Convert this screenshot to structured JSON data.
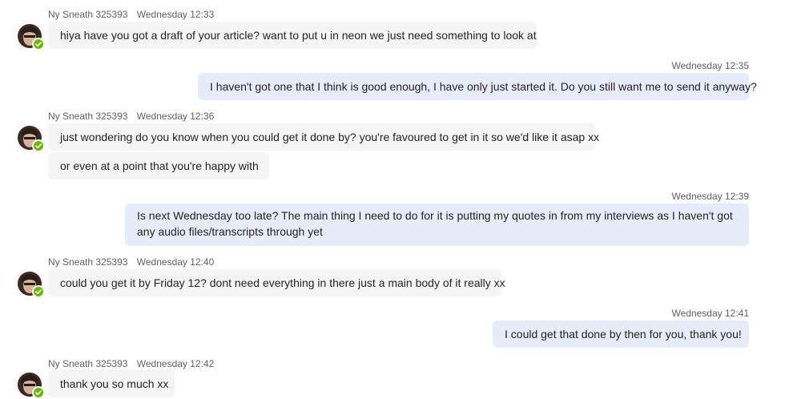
{
  "messages": [
    {
      "kind": "in",
      "sender": "Ny Sneath 325393",
      "time": "Wednesday 12:33",
      "lines": [
        "hiya have you got a draft of your article? want to put u in neon we just need something to look at"
      ]
    },
    {
      "kind": "out",
      "time": "Wednesday 12:35",
      "lines": [
        "I haven't got one that I think is good enough, I have only just started it. Do you still want me to send it anyway?"
      ]
    },
    {
      "kind": "in",
      "sender": "Ny Sneath 325393",
      "time": "Wednesday 12:36",
      "lines": [
        "just wondering do you know when you could get it done by? you're favoured to get in it so we'd like it asap xx",
        "or even at a point that you're happy with"
      ]
    },
    {
      "kind": "out",
      "time": "Wednesday 12:39",
      "lines": [
        "Is next Wednesday too late? The main thing I need to do for it is putting my quotes in from my interviews as I haven't got any audio files/transcripts through yet"
      ]
    },
    {
      "kind": "in",
      "sender": "Ny Sneath 325393",
      "time": "Wednesday 12:40",
      "lines": [
        "could you get it by Friday 12? dont need everything in there just a main body of it really xx"
      ]
    },
    {
      "kind": "out",
      "time": "Wednesday 12:41",
      "lines": [
        "I could get that done by then for you, thank you!"
      ]
    },
    {
      "kind": "in",
      "sender": "Ny Sneath 325393",
      "time": "Wednesday 12:42",
      "lines": [
        "thank you so much xx"
      ]
    }
  ],
  "colors": {
    "incoming_bubble": "#f5f5f5",
    "outgoing_bubble": "#e8ebfa",
    "meta_text": "#616161",
    "presence_available": "#6bb700"
  },
  "icons": {
    "avatar": "contact-photo",
    "presence": "available-checkmark-icon"
  }
}
